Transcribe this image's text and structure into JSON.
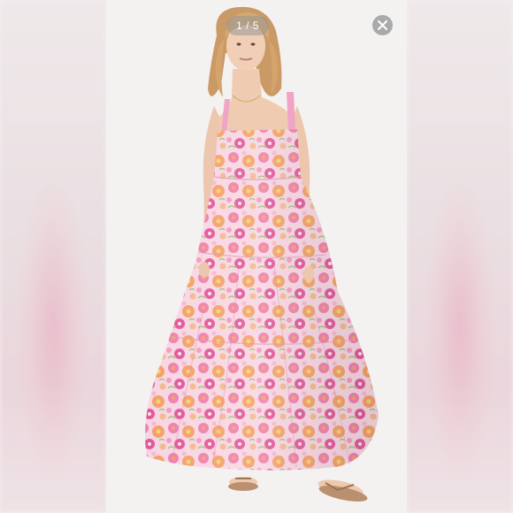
{
  "viewer": {
    "counter": "1 / 5",
    "current_index": 1,
    "total_images": 5,
    "close_icon": "close-icon"
  },
  "colors": {
    "dress_pink": "#ef7fb0",
    "dress_orange": "#f6a06a",
    "dress_base": "#f7d6e2",
    "background": "#f4f1f1"
  }
}
